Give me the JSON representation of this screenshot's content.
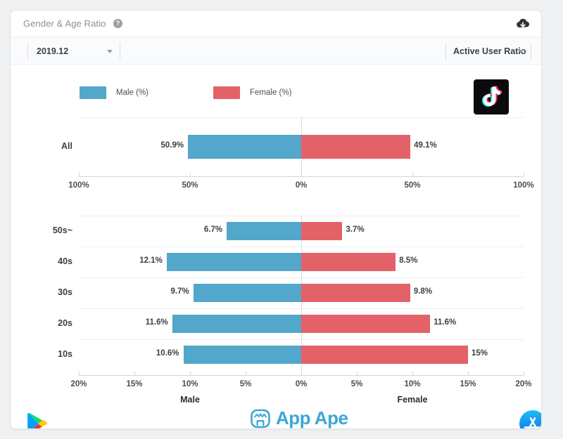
{
  "header": {
    "title": "Gender & Age Ratio",
    "help_icon": "question-mark-icon",
    "download_icon": "cloud-download-icon"
  },
  "toolbar": {
    "period_value": "2019.12",
    "metric_value": "Active User Ratio"
  },
  "legend": [
    {
      "label": "Male (%)",
      "color": "#52a7ca"
    },
    {
      "label": "Female (%)",
      "color": "#e26268"
    }
  ],
  "app": {
    "icon": "tiktok-logo"
  },
  "footer": {
    "brand": "App Ape",
    "play_store_icon": "google-play-icon",
    "app_store_icon": "apple-app-store-icon"
  },
  "colors": {
    "male": "#52a7ca",
    "female": "#e26268",
    "card": "#ffffff",
    "page": "#f0f1f2",
    "brand": "#3ba7d6"
  },
  "chart_data": [
    {
      "type": "bar",
      "orientation": "horizontal-diverging",
      "title": "All",
      "categories": [
        "All"
      ],
      "series": [
        {
          "name": "Male (%)",
          "values": [
            50.9
          ],
          "labels": [
            "50.9%"
          ],
          "color": "#52a7ca",
          "side": "left"
        },
        {
          "name": "Female (%)",
          "values": [
            49.1
          ],
          "labels": [
            "49.1%"
          ],
          "color": "#e26268",
          "side": "right"
        }
      ],
      "xlim": [
        -100,
        100
      ],
      "xticks": [
        -100,
        -50,
        0,
        50,
        100
      ],
      "xticklabels": [
        "100%",
        "50%",
        "0%",
        "50%",
        "100%"
      ],
      "grid": true,
      "legend_position": "top-left"
    },
    {
      "type": "bar",
      "orientation": "horizontal-diverging",
      "title": "",
      "categories": [
        "50s~",
        "40s",
        "30s",
        "20s",
        "10s"
      ],
      "series": [
        {
          "name": "Male (%)",
          "values": [
            6.7,
            12.1,
            9.7,
            11.6,
            10.6
          ],
          "labels": [
            "6.7%",
            "12.1%",
            "9.7%",
            "11.6%",
            "10.6%"
          ],
          "color": "#52a7ca",
          "side": "left"
        },
        {
          "name": "Female (%)",
          "values": [
            3.7,
            8.5,
            9.8,
            11.6,
            15.0
          ],
          "labels": [
            "3.7%",
            "8.5%",
            "9.8%",
            "11.6%",
            "15%"
          ],
          "color": "#e26268",
          "side": "right"
        }
      ],
      "xlim": [
        -20,
        20
      ],
      "xticks": [
        -20,
        -15,
        -10,
        -5,
        0,
        5,
        10,
        15,
        20
      ],
      "xticklabels": [
        "20%",
        "15%",
        "10%",
        "5%",
        "0%",
        "5%",
        "10%",
        "15%",
        "20%"
      ],
      "axis_labels": {
        "left": "Male",
        "right": "Female"
      },
      "grid": true
    }
  ]
}
